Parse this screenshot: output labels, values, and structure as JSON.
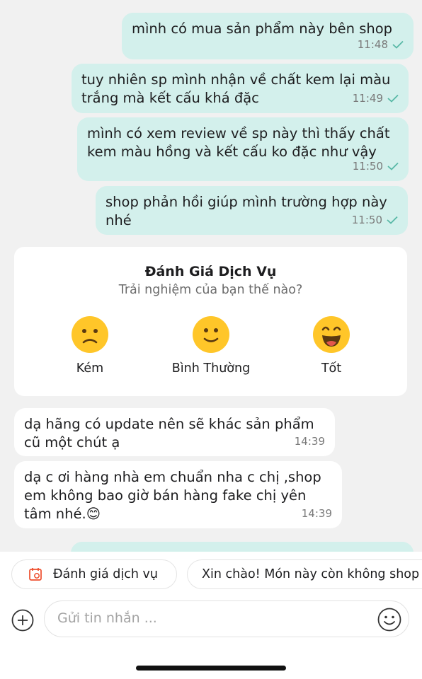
{
  "messages_out": [
    {
      "text": "mình có mua sản phẩm này bên shop",
      "time": "11:48"
    },
    {
      "text": "tuy nhiên sp mình nhận về chất kem lại màu\ntrắng mà kết cấu khá đặc",
      "time": "11:49"
    },
    {
      "text": "mình có xem review về sp này thì thấy chất\nkem màu hồng và kết cấu ko đặc như vậy",
      "time": "11:50"
    },
    {
      "text": "shop phản hồi giúp mình trường hợp này\nnhé",
      "time": "11:50"
    }
  ],
  "rating_card": {
    "title": "Đánh Giá Dịch Vụ",
    "subtitle": "Trải nghiệm của bạn thế nào?",
    "options": [
      {
        "label": "Kém",
        "icon": "sad-face-icon"
      },
      {
        "label": "Bình Thường",
        "icon": "neutral-face-icon"
      },
      {
        "label": "Tốt",
        "icon": "happy-face-icon"
      }
    ]
  },
  "messages_in": [
    {
      "text": "dạ hãng có update nên sẽ khác sản phẩm\ncũ một chút ạ",
      "time": "14:39"
    },
    {
      "text": "dạ c ơi hàng nhà em chuẩn nha c chị ,shop\nem không bao giờ bán hàng fake chị yên\ntâm nhé.😊",
      "time": "14:39"
    }
  ],
  "quick_replies": [
    {
      "label": "Đánh giá dịch vụ",
      "icon": "rate-service-icon"
    },
    {
      "label": "Xin chào! Món này còn không shop"
    }
  ],
  "composer": {
    "placeholder": "Gửi tin nhắn ..."
  },
  "colors": {
    "outgoing_bubble": "#d3f0ec",
    "incoming_bubble": "#ffffff",
    "emoji_yellow": "#ffc629",
    "accent_icon": "#ee4d2d"
  }
}
